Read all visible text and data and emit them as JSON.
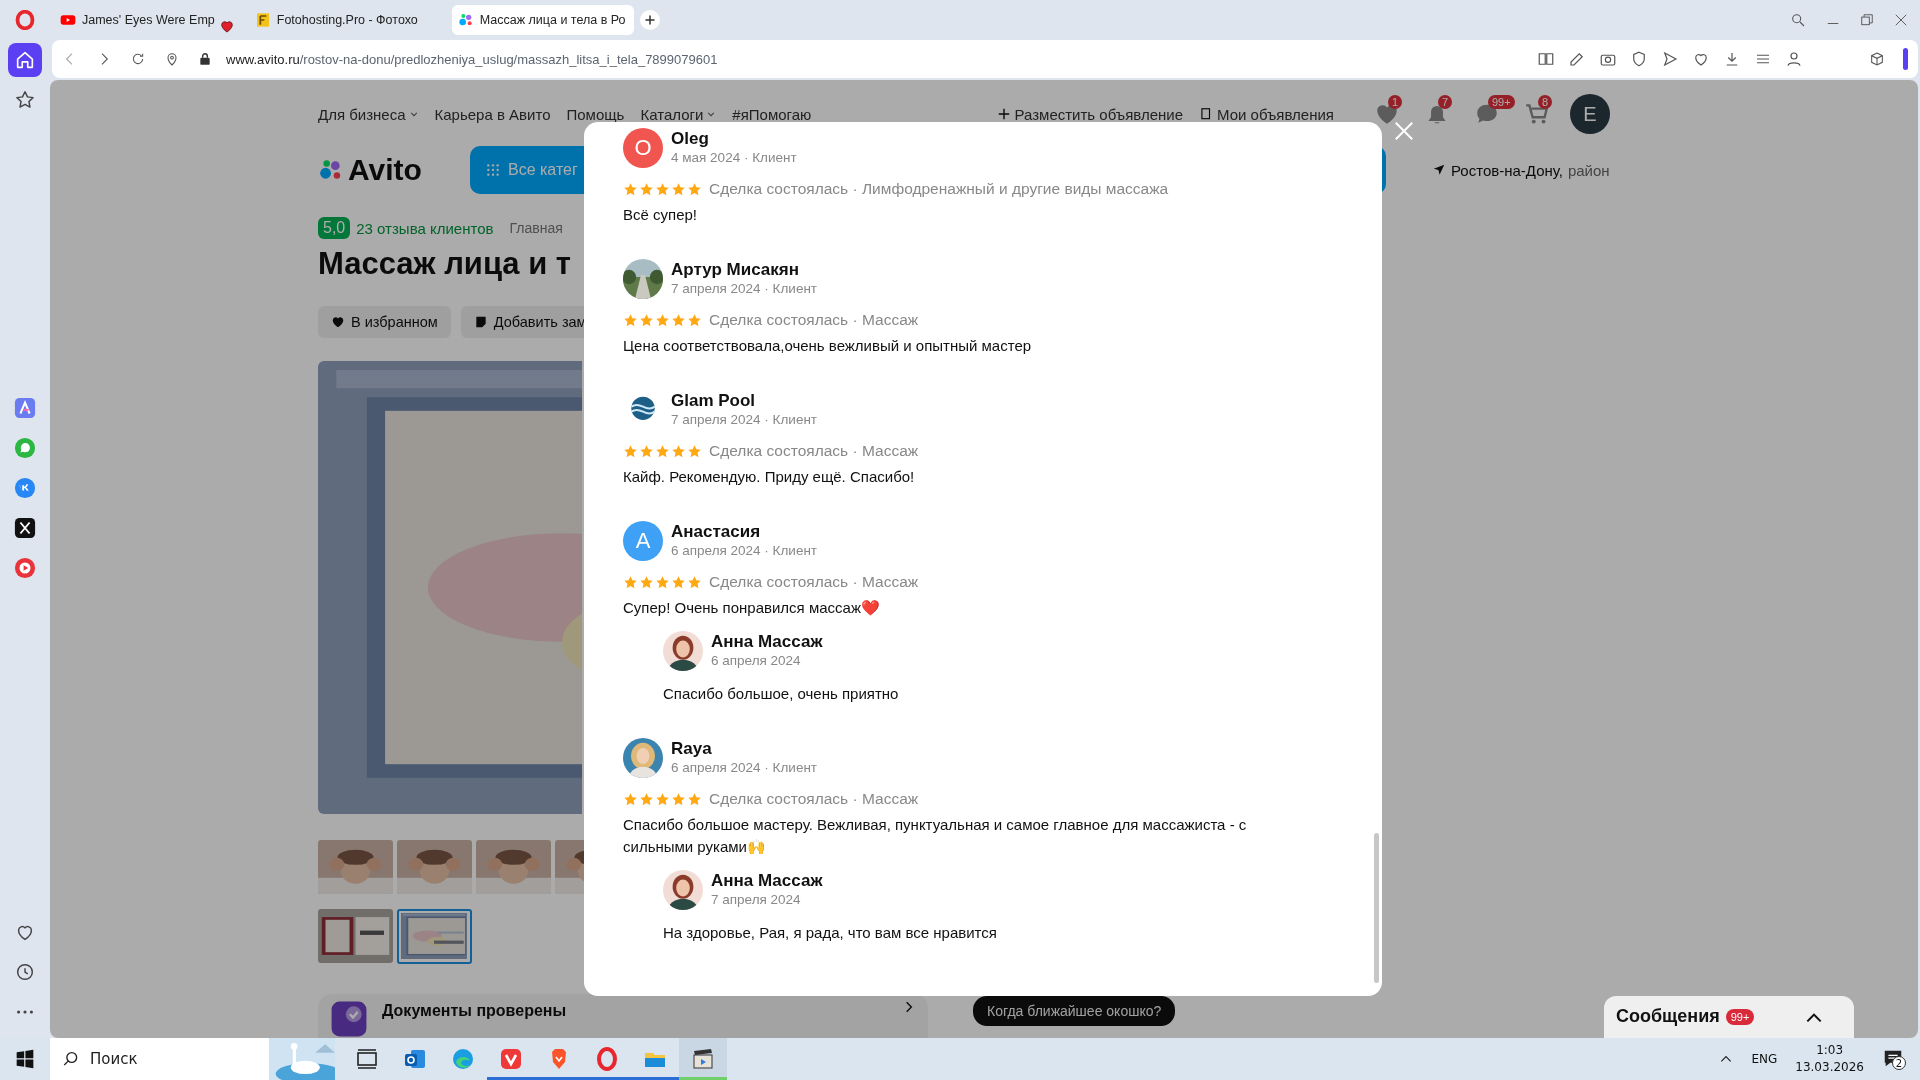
{
  "browser": {
    "tabs": [
      {
        "kind": "video",
        "title": "James' Eyes Were Emp",
        "selected": false,
        "playing": true
      },
      {
        "kind": "photohost",
        "title": "Fotohosting.Pro - Фотохо",
        "selected": false,
        "playing": false
      },
      {
        "kind": "avito",
        "title": "Массаж лица и тела в Ро",
        "selected": true,
        "playing": false
      }
    ],
    "url_host": "www.avito.ru",
    "url_path": "/rostov-na-donu/predlozheniya_uslug/massazh_litsa_i_tela_7899079601"
  },
  "sidebar": {
    "items": [
      {
        "kind": "home",
        "selected": true
      },
      {
        "kind": "bookmarks",
        "selected": false
      },
      {
        "kind": "aria",
        "selected": false
      },
      {
        "kind": "whatsapp",
        "selected": false
      },
      {
        "kind": "vk",
        "selected": false
      },
      {
        "kind": "x",
        "selected": false
      },
      {
        "kind": "music",
        "selected": false
      },
      {
        "kind": "heart",
        "selected": false
      },
      {
        "kind": "history",
        "selected": false
      },
      {
        "kind": "more",
        "selected": false
      }
    ]
  },
  "page": {
    "nav": [
      {
        "label": "Для бизнеса",
        "has_menu": true
      },
      {
        "label": "Карьера в Авито",
        "has_menu": false
      },
      {
        "label": "Помощь",
        "has_menu": false
      },
      {
        "label": "Каталоги",
        "has_menu": true
      },
      {
        "label": "#яПомогаю",
        "has_menu": false
      }
    ],
    "post_ad": "Разместить объявление",
    "my_ads": "Мои объявления",
    "header_icons": [
      {
        "kind": "favorites",
        "badge": "1"
      },
      {
        "kind": "notifications",
        "badge": "7"
      },
      {
        "kind": "messages",
        "badge": "99+"
      },
      {
        "kind": "cart",
        "badge": "8"
      }
    ],
    "avatar_letter": "E",
    "logo": "Avito",
    "category_button": "Все катег",
    "location": "Ростов-на-Дону,",
    "location_area": "район",
    "rating": "5,0",
    "reviews_link": "23 отзыва клиентов",
    "breadcrumb": "Главная",
    "title": "Массаж лица и т",
    "actions": [
      {
        "kind": "favorite",
        "label": "В избранном"
      },
      {
        "kind": "note",
        "label": "Добавить зам"
      }
    ],
    "thumbnails": [
      {
        "kind": "massage",
        "selected": false
      },
      {
        "kind": "massage",
        "selected": false
      },
      {
        "kind": "massage",
        "selected": false
      },
      {
        "kind": "massage",
        "selected": false
      },
      {
        "kind": "document",
        "selected": false
      },
      {
        "kind": "certificate",
        "selected": true
      }
    ],
    "documents_card": "Документы проверены",
    "quick_question": "Когда ближайшее окошко?",
    "messages_widget": {
      "label": "Сообщения",
      "badge": "99+"
    }
  },
  "reviews_modal": {
    "reviews": [
      {
        "kind": "letter",
        "letter": "O",
        "color": "#f0554f",
        "name": "Oleg",
        "meta": "4 мая 2024 · Клиент",
        "stars": 5,
        "deal": "Сделка состоялась · Лимфодренажный и другие виды массажа",
        "text": "Всё супер!"
      },
      {
        "name": "Артур Мисакян",
        "meta": "7 апреля 2024 · Клиент",
        "stars": 5,
        "deal": "Сделка состоялась · Массаж",
        "text": "Цена соответствовала,очень вежливый и опытный мастер"
      },
      {
        "kind": "logo",
        "name": "Glam Pool",
        "meta": "7 апреля 2024 · Клиент",
        "stars": 5,
        "deal": "Сделка состоялась · Массаж",
        "text": "Кайф. Рекомендую. Приду ещё. Спасибо!"
      },
      {
        "kind": "letter",
        "letter": "А",
        "color": "#3ea1f5",
        "name": "Анастасия",
        "meta": "6 апреля 2024 · Клиент",
        "stars": 5,
        "deal": "Сделка состоялась · Массаж",
        "text": "Супер! Очень понравился массаж❤️",
        "replies": [
          {
            "name": "Анна Массаж",
            "date": "6 апреля 2024",
            "text": "Спасибо большое, очень приятно"
          }
        ]
      },
      {
        "name": "Raya",
        "meta": "6 апреля 2024 · Клиент",
        "stars": 5,
        "deal": "Сделка состоялась · Массаж",
        "text": "Спасибо большое мастеру. Вежливая, пунктуальная и самое главное для массажиста - с сильными руками🙌",
        "replies": [
          {
            "name": "Анна Массаж",
            "date": "7 апреля 2024",
            "text": "На здоровье, Рая, я рада, что вам все нравится"
          }
        ]
      }
    ]
  },
  "taskbar": {
    "search_placeholder": "Поиск",
    "apps": [
      {
        "kind": "taskview",
        "running": false,
        "selected": false
      },
      {
        "kind": "outlook",
        "running": false,
        "selected": false
      },
      {
        "kind": "edge",
        "running": false,
        "selected": false
      },
      {
        "kind": "vivaldi",
        "running": true,
        "selected": false
      },
      {
        "kind": "brave",
        "running": true,
        "selected": false
      },
      {
        "kind": "opera",
        "running": true,
        "selected": false
      },
      {
        "kind": "explorer",
        "running": true,
        "selected": false
      },
      {
        "kind": "media",
        "running": true,
        "selected": true
      }
    ],
    "language": "ENG",
    "time": "1:03",
    "date": "13.03.2026",
    "notifications": "2"
  }
}
